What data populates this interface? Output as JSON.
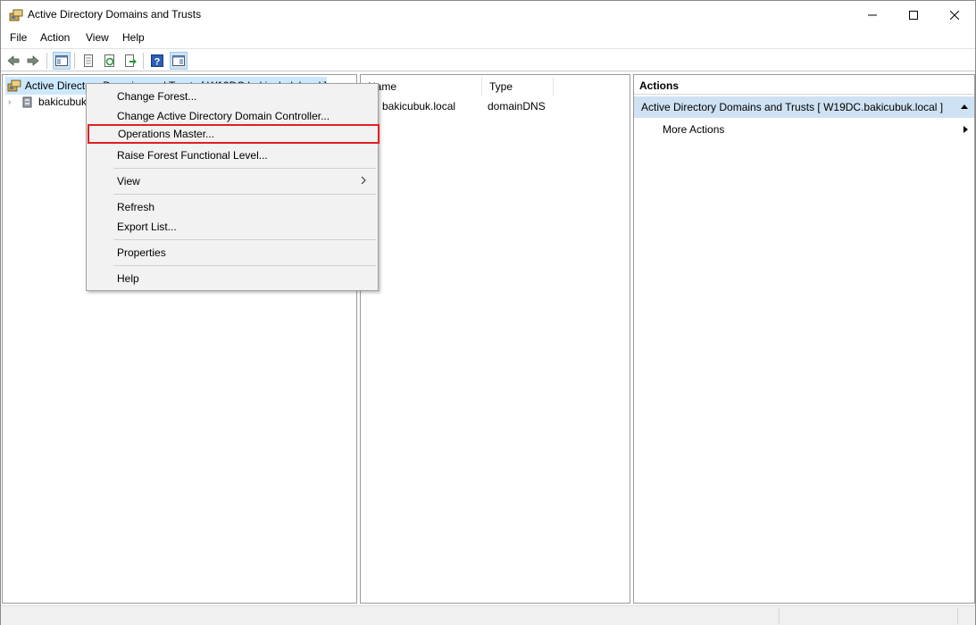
{
  "window": {
    "title": "Active Directory Domains and Trusts"
  },
  "menubar": {
    "items": [
      "File",
      "Action",
      "View",
      "Help"
    ]
  },
  "toolbar": {
    "icons": [
      "back-arrow-icon",
      "forward-arrow-icon",
      "show-hide-console-tree-icon",
      "properties-icon",
      "refresh-icon",
      "export-list-icon",
      "help-icon",
      "show-hide-action-pane-icon"
    ]
  },
  "tree": {
    "root_label": "Active Directory Domains and Trusts [ W19DC.bakicubuk.local ]",
    "child_label": "bakicubuk.local"
  },
  "list": {
    "columns": [
      "Name",
      "Type"
    ],
    "rows": [
      {
        "name": "bakicubuk.local",
        "type": "domainDNS"
      }
    ]
  },
  "actions": {
    "header": "Actions",
    "section": "Active Directory Domains and Trusts [ W19DC.bakicubuk.local ]",
    "more": "More Actions"
  },
  "context_menu": {
    "items": [
      "Change Forest...",
      "Change Active Directory Domain Controller...",
      "Operations Master...",
      "Raise Forest Functional Level...",
      "View",
      "Refresh",
      "Export List...",
      "Properties",
      "Help"
    ],
    "highlighted": "Operations Master..."
  },
  "colors": {
    "selection": "#cce8ff",
    "highlight_border": "#e0201f",
    "actions_section": "#cfe2f3"
  }
}
